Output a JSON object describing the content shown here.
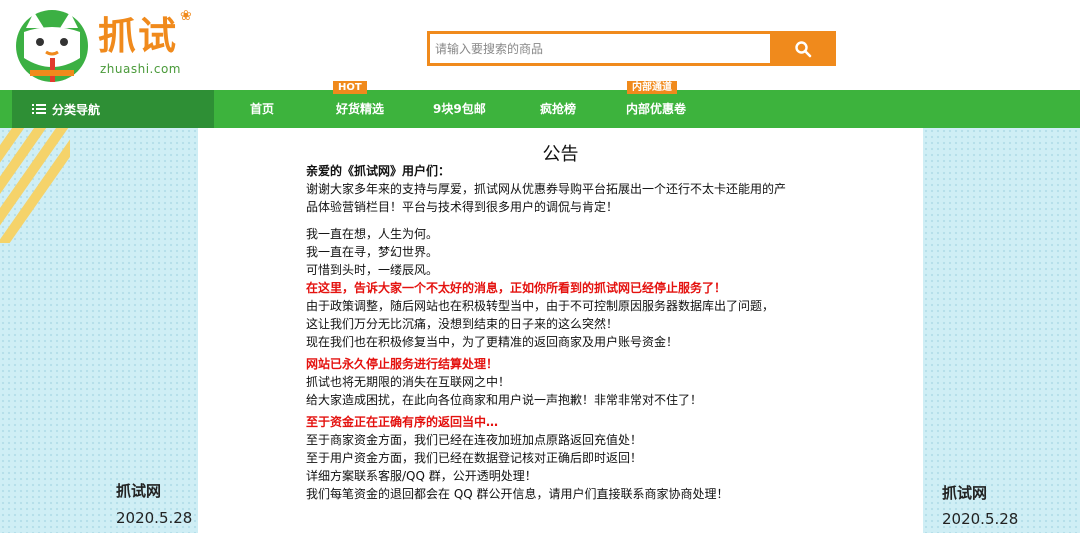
{
  "header": {
    "logo_text": "抓试",
    "logo_sub": "zhuashi.com",
    "search_placeholder": "请输入要搜索的商品"
  },
  "nav": {
    "category_label": "分类导航",
    "items": [
      {
        "label": "首页",
        "badge": ""
      },
      {
        "label": "好货精选",
        "badge": "HOT"
      },
      {
        "label": "9块9包邮",
        "badge": ""
      },
      {
        "label": "疯抢榜",
        "badge": ""
      },
      {
        "label": "内部优惠卷",
        "badge": "内部通道"
      }
    ]
  },
  "notice": {
    "title": "公告",
    "lines": [
      "亲爱的《抓试网》用户们：",
      "谢谢大家多年来的支持与厚爱，抓试网从优惠券导购平台拓展出一个还行不太卡还能用的产",
      "品体验营销栏目！平台与技术得到很多用户的调侃与肯定！",
      "我一直在想，人生为何。",
      "我一直在寻，梦幻世界。",
      "可惜到头时，一缕辰风。",
      "在这里，告诉大家一个不太好的消息，正如你所看到的抓试网已经停止服务了！",
      "由于政策调整，随后网站也在积极转型当中，由于不可控制原因服务器数据库出了问题，",
      "这让我们万分无比沉痛，没想到结束的日子来的这么突然！",
      "现在我们也在积极修复当中，为了更精准的返回商家及用户账号资金！",
      "网站已永久停止服务进行结算处理！",
      "抓试也将无期限的消失在互联网之中！",
      "给大家造成困扰，在此向各位商家和用户说一声抱歉！非常非常对不住了！",
      "至于资金正在正确有序的返回当中…",
      "至于商家资金方面，我们已经在连夜加班加点原路返回充值处！",
      "至于用户资金方面，我们已经在数据登记核对正确后即时返回！",
      "详细方案联系客服/QQ 群，公开透明处理！",
      "我们每笔资金的退回都会在 QQ 群公开信息，请用户们直接联系商家协商处理！"
    ]
  },
  "signature": {
    "name": "抓试网",
    "date": "2020.5.28"
  },
  "colors": {
    "brand_orange": "#f08a1c",
    "nav_green": "#3db33d",
    "nav_dark_green": "#2e8f35",
    "alert_red": "#e4120f",
    "side_bg": "#cfeef5"
  }
}
